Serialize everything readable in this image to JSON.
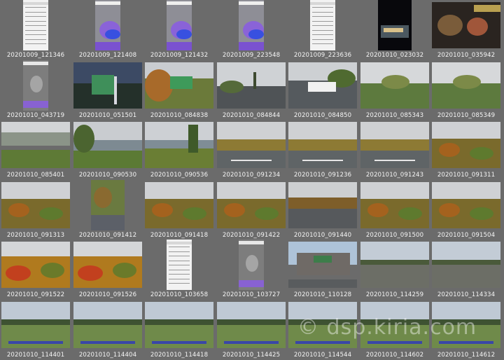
{
  "thumbnails": [
    {
      "label": "20201009_121346",
      "scene": "phone_list",
      "orient": "portw"
    },
    {
      "label": "20201009_121408",
      "scene": "phone_map",
      "orient": "portw"
    },
    {
      "label": "20201009_121432",
      "scene": "phone_map",
      "orient": "portw"
    },
    {
      "label": "20201009_223548",
      "scene": "phone_map",
      "orient": "portw"
    },
    {
      "label": "20201009_223636",
      "scene": "phone_list",
      "orient": "portw"
    },
    {
      "label": "20201010_023032",
      "scene": "night",
      "orient": "port"
    },
    {
      "label": "20201010_035942",
      "scene": "food",
      "orient": "land"
    },
    {
      "label": "20201010_043719",
      "scene": "phone_gray",
      "orient": "portw"
    },
    {
      "label": "20201010_051501",
      "scene": "dusk_sign",
      "orient": "land"
    },
    {
      "label": "20201010_084838",
      "scene": "sign_autumn",
      "orient": "land"
    },
    {
      "label": "20201010_084844",
      "scene": "parking",
      "orient": "land"
    },
    {
      "label": "20201010_084850",
      "scene": "parking_car",
      "orient": "land"
    },
    {
      "label": "20201010_085343",
      "scene": "misty_green",
      "orient": "land"
    },
    {
      "label": "20201010_085349",
      "scene": "misty_green",
      "orient": "land"
    },
    {
      "label": "20201010_085401",
      "scene": "misty_mtn",
      "orient": "land"
    },
    {
      "label": "20201010_090530",
      "scene": "lake",
      "orient": "land"
    },
    {
      "label": "20201010_090536",
      "scene": "lake_tree",
      "orient": "land"
    },
    {
      "label": "20201010_091234",
      "scene": "road_autumn",
      "orient": "land"
    },
    {
      "label": "20201010_091236",
      "scene": "road_autumn",
      "orient": "land"
    },
    {
      "label": "20201010_091243",
      "scene": "road_autumn",
      "orient": "land"
    },
    {
      "label": "20201010_091311",
      "scene": "autumn",
      "orient": "land"
    },
    {
      "label": "20201010_091313",
      "scene": "autumn",
      "orient": "land"
    },
    {
      "label": "20201010_091412",
      "scene": "foliage_close",
      "orient": "port"
    },
    {
      "label": "20201010_091418",
      "scene": "autumn",
      "orient": "land"
    },
    {
      "label": "20201010_091422",
      "scene": "autumn",
      "orient": "land"
    },
    {
      "label": "20201010_091440",
      "scene": "parking_empty",
      "orient": "land"
    },
    {
      "label": "20201010_091500",
      "scene": "autumn",
      "orient": "land"
    },
    {
      "label": "20201010_091504",
      "scene": "autumn",
      "orient": "land"
    },
    {
      "label": "20201010_091522",
      "scene": "autumn_bright",
      "orient": "land"
    },
    {
      "label": "20201010_091526",
      "scene": "autumn_bright",
      "orient": "land"
    },
    {
      "label": "20201010_103658",
      "scene": "phone_list",
      "orient": "portw"
    },
    {
      "label": "20201010_103727",
      "scene": "phone_gray",
      "orient": "portw"
    },
    {
      "label": "20201010_110128",
      "scene": "store",
      "orient": "land"
    },
    {
      "label": "20201010_114259",
      "scene": "plain",
      "orient": "land"
    },
    {
      "label": "20201010_114334",
      "scene": "plain",
      "orient": "land"
    },
    {
      "label": "20201010_114401",
      "scene": "plain_green",
      "orient": "land"
    },
    {
      "label": "20201010_114404",
      "scene": "plain_green",
      "orient": "land"
    },
    {
      "label": "20201010_114418",
      "scene": "plain_green",
      "orient": "land"
    },
    {
      "label": "20201010_114425",
      "scene": "plain_green",
      "orient": "land"
    },
    {
      "label": "20201010_114544",
      "scene": "plain_green",
      "orient": "land"
    },
    {
      "label": "20201010_114602",
      "scene": "plain_green",
      "orient": "land"
    },
    {
      "label": "20201010_114612",
      "scene": "plain_green",
      "orient": "land"
    }
  ],
  "watermark": "© dsp.kiria.com"
}
